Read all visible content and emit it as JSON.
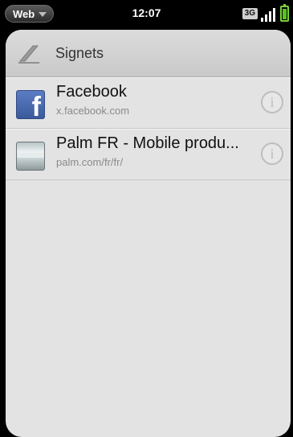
{
  "status_bar": {
    "app_menu_label": "Web",
    "time": "12:07",
    "network": "3G",
    "battery_level": 0.9,
    "signal_bars": 4
  },
  "header": {
    "title": "Signets",
    "icon": "bookmark-icon"
  },
  "bookmarks": [
    {
      "title": "Facebook",
      "url": "x.facebook.com",
      "favicon": "facebook-favicon",
      "favicon_letter": "f",
      "info_icon": "i"
    },
    {
      "title": "Palm FR - Mobile produ...",
      "url": "palm.com/fr/fr/",
      "favicon": "palm-favicon",
      "info_icon": "i"
    }
  ],
  "colors": {
    "battery": "#55c41c",
    "facebook_blue": "#3a5a9b"
  }
}
